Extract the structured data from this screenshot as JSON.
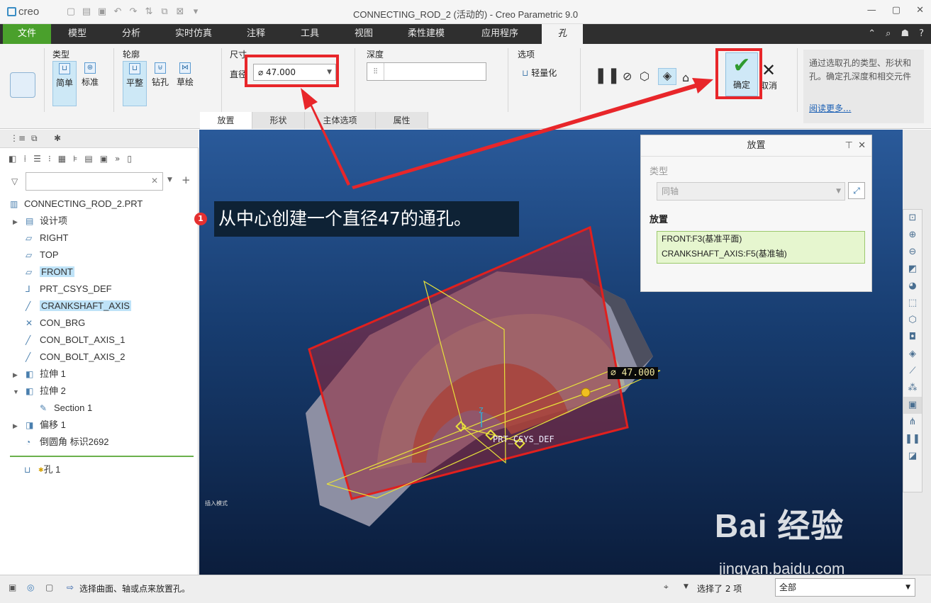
{
  "app": {
    "logo": "creo",
    "window_title": "CONNECTING_ROD_2 (活动的) - Creo Parametric 9.0"
  },
  "menu": {
    "tabs": [
      "文件",
      "模型",
      "分析",
      "实时仿真",
      "注释",
      "工具",
      "视图",
      "柔性建模",
      "应用程序"
    ],
    "active_tab": "孔"
  },
  "ribbon": {
    "type_label": "类型",
    "type_simple": "简单",
    "type_standard": "标准",
    "profile_label": "轮廓",
    "profile_flat": "平整",
    "profile_drill": "钻孔",
    "profile_sketch": "草绘",
    "dimension_label": "尺寸",
    "diameter_label": "直径",
    "diameter_value": "⌀ 47.000",
    "depth_label": "深度",
    "options_label": "选项",
    "lightweight": "轻量化",
    "ok_label": "确定",
    "cancel_label": "取消",
    "help_text": "通过选取孔的类型、形状和孔。确定孔深度和相交元件",
    "help_more": "阅读更多...",
    "sub_tabs": [
      "放置",
      "形状",
      "主体选项",
      "属性"
    ]
  },
  "model_tree": {
    "items": [
      {
        "label": "CONNECTING_ROD_2.PRT",
        "icon": "part-icon",
        "expand": "",
        "hl": false,
        "indent": 0
      },
      {
        "label": "设计项",
        "icon": "design-items-icon",
        "expand": "▶",
        "hl": false,
        "indent": 1
      },
      {
        "label": "RIGHT",
        "icon": "plane-icon",
        "expand": "",
        "hl": false,
        "indent": 1
      },
      {
        "label": "TOP",
        "icon": "plane-icon",
        "expand": "",
        "hl": false,
        "indent": 1
      },
      {
        "label": "FRONT",
        "icon": "plane-icon",
        "expand": "",
        "hl": true,
        "indent": 1
      },
      {
        "label": "PRT_CSYS_DEF",
        "icon": "csys-icon",
        "expand": "",
        "hl": false,
        "indent": 1
      },
      {
        "label": "CRANKSHAFT_AXIS",
        "icon": "axis-icon",
        "expand": "",
        "hl": true,
        "indent": 1
      },
      {
        "label": "CON_BRG",
        "icon": "point-icon",
        "expand": "",
        "hl": false,
        "indent": 1
      },
      {
        "label": "CON_BOLT_AXIS_1",
        "icon": "axis-icon",
        "expand": "",
        "hl": false,
        "indent": 1
      },
      {
        "label": "CON_BOLT_AXIS_2",
        "icon": "axis-icon",
        "expand": "",
        "hl": false,
        "indent": 1
      },
      {
        "label": "拉伸 1",
        "icon": "extrude-icon",
        "expand": "▶",
        "hl": false,
        "indent": 1
      },
      {
        "label": "拉伸 2",
        "icon": "extrude-icon",
        "expand": "▼",
        "hl": false,
        "indent": 1
      },
      {
        "label": "Section 1",
        "icon": "sketch-icon",
        "expand": "",
        "hl": false,
        "indent": 2
      },
      {
        "label": "偏移 1",
        "icon": "offset-icon",
        "expand": "▶",
        "hl": false,
        "indent": 1
      },
      {
        "label": "倒圆角 标识2692",
        "icon": "round-icon",
        "expand": "",
        "hl": false,
        "indent": 1
      }
    ],
    "new_item": "孔 1"
  },
  "placement_panel": {
    "title": "放置",
    "type_label": "类型",
    "type_value": "同轴",
    "placement_label": "放置",
    "references": [
      "FRONT:F3(基准平面)",
      "CRANKSHAFT_AXIS:F5(基准轴)"
    ]
  },
  "graphics": {
    "dimension_tag": "⌀ 47.000",
    "csys_label": "PRT_CSYS_DEF",
    "axis_label": "Z",
    "mode_label": "插入模式"
  },
  "annotation": {
    "badge": "1",
    "text": "从中心创建一个直径47的通孔。"
  },
  "status": {
    "message": "选择曲面、轴或点来放置孔。",
    "selected": "选择了 2 项",
    "filter": "全部"
  },
  "watermark": {
    "brand": "Bai 经验",
    "url": "jingyan.baidu.com"
  }
}
